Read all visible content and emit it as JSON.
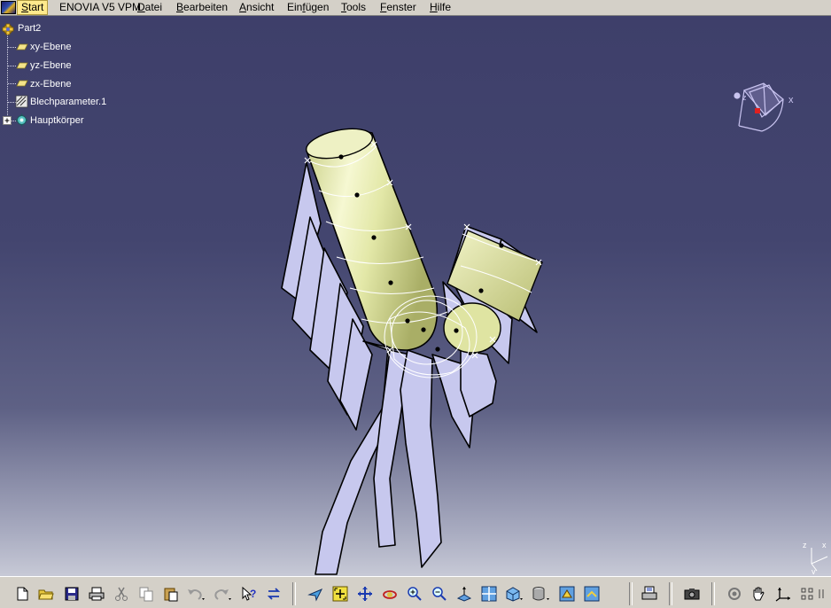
{
  "menubar": {
    "items": [
      {
        "pre": "",
        "mn": "S",
        "post": "tart"
      },
      {
        "pre": "ENOVIA V5 VPM",
        "mn": "",
        "post": ""
      },
      {
        "pre": "",
        "mn": "D",
        "post": "atei"
      },
      {
        "pre": "",
        "mn": "B",
        "post": "earbeiten"
      },
      {
        "pre": "",
        "mn": "A",
        "post": "nsicht"
      },
      {
        "pre": "Ein",
        "mn": "f",
        "post": "ügen"
      },
      {
        "pre": "",
        "mn": "T",
        "post": "ools"
      },
      {
        "pre": "",
        "mn": "F",
        "post": "enster"
      },
      {
        "pre": "",
        "mn": "H",
        "post": "ilfe"
      }
    ]
  },
  "spec_tree": {
    "root": "Part2",
    "items": [
      "xy-Ebene",
      "yz-Ebene",
      "zx-Ebene",
      "Blechparameter.1",
      "Hauptkörper"
    ]
  },
  "compass": {
    "x": "x",
    "y": "y",
    "z": "z"
  },
  "axis_triad": {
    "x": "x",
    "y": "y",
    "z": "z"
  },
  "toolbar": {
    "icons": [
      "new-document-icon",
      "open-folder-icon",
      "save-icon",
      "print-icon",
      "cut-icon",
      "copy-icon",
      "paste-icon",
      "undo-icon",
      "redo-icon",
      "whats-this-icon",
      "swap-icon",
      "fly-mode-icon",
      "fit-all-icon",
      "pan-icon",
      "rotate-icon",
      "zoom-in-icon",
      "zoom-out-icon",
      "normal-view-icon",
      "multi-view-icon",
      "iso-view-icon",
      "render-style-icon",
      "hide-show-icon",
      "swap-visible-icon",
      "print-spec-icon",
      "camera-icon",
      "rotate-view-icon",
      "grab-icon",
      "axis-icon",
      "compass-icon",
      "more-icon"
    ]
  },
  "colors": {
    "viewport_top": "#3e3f6a",
    "viewport_bottom": "#c7c9d6",
    "cylinder": "#e6ebb0",
    "sheet": "#c7c8ee",
    "menu_active": "#ffe98c"
  }
}
